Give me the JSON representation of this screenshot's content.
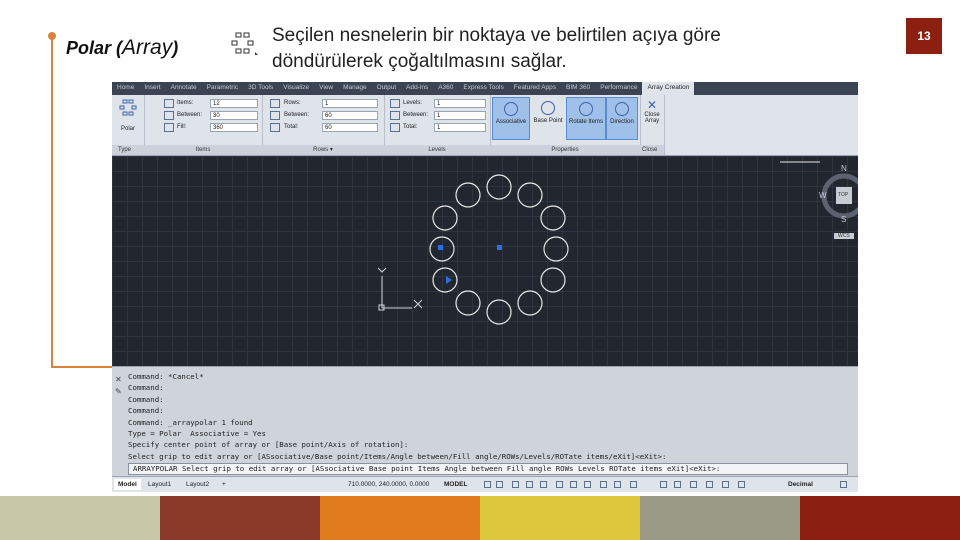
{
  "slide": {
    "heading_a": "Polar (",
    "heading_b": "Array",
    "heading_c": ")",
    "description_line1": "Seçilen nesnelerin bir noktaya ve belirtilen açıya göre",
    "description_line2": "döndürülerek çoğaltılmasını sağlar.",
    "page_number": "13",
    "accent_color": "#d9833a",
    "footer_colors": [
      "#c8c8a8",
      "#8b3a2a",
      "#e07b1e",
      "#dcc63a",
      "#9a9a86",
      "#8b2010"
    ]
  },
  "app": {
    "tabs": [
      "Home",
      "Insert",
      "Annotate",
      "Parametric",
      "3D Tools",
      "Visualize",
      "View",
      "Manage",
      "Output",
      "Add-ins",
      "A360",
      "Express Tools",
      "Featured Apps",
      "BIM 360",
      "Performance",
      "Array Creation"
    ],
    "ribbon": {
      "type_panel": {
        "button": "Polar",
        "title": "Type"
      },
      "items_panel": {
        "title": "Items",
        "rows": [
          {
            "label": "Items:",
            "value": "12"
          },
          {
            "label": "Between:",
            "value": "30"
          },
          {
            "label": "Fill:",
            "value": "360"
          }
        ]
      },
      "rows_panel": {
        "title": "Rows ▾",
        "rows": [
          {
            "label": "Rows:",
            "value": "1"
          },
          {
            "label": "Between:",
            "value": "60"
          },
          {
            "label": "Total:",
            "value": "60"
          }
        ]
      },
      "levels_panel": {
        "title": "Levels",
        "rows": [
          {
            "label": "Levels:",
            "value": "1"
          },
          {
            "label": "Between:",
            "value": "1"
          },
          {
            "label": "Total:",
            "value": "1"
          }
        ]
      },
      "properties_panel": {
        "title": "Properties",
        "buttons": [
          "Associative",
          "Base Point",
          "Rotate Items",
          "Direction"
        ]
      },
      "close_panel": {
        "title": "Close",
        "button_line1": "Close",
        "button_line2": "Array"
      }
    },
    "viewcube": {
      "north": "N",
      "west": "W",
      "south": "S",
      "face": "TOP",
      "wcs": "WCS"
    },
    "command_history": [
      "Command: *Cancel*",
      "Command:",
      "Command:",
      "Command:",
      "Command: _arraypolar 1 found",
      "Type = Polar  Associative = Yes",
      "Specify center point of array or [Base point/Axis of rotation]:",
      "Select grip to edit array or [ASsociative/Base point/Items/Angle between/Fill angle/ROWs/Levels/ROTate items/eXit]<eXit>:"
    ],
    "command_prompt": "ARRAYPOLAR Select grip to edit array or [ASsociative Base point Items Angle between Fill angle ROWs Levels ROTate items eXit]<eXit>:",
    "layout_tabs": [
      "Model",
      "Layout1",
      "Layout2",
      "+"
    ],
    "coordinates": "710.0000, 240.0000, 0.0000",
    "status_model": "MODEL",
    "units": "Decimal"
  }
}
